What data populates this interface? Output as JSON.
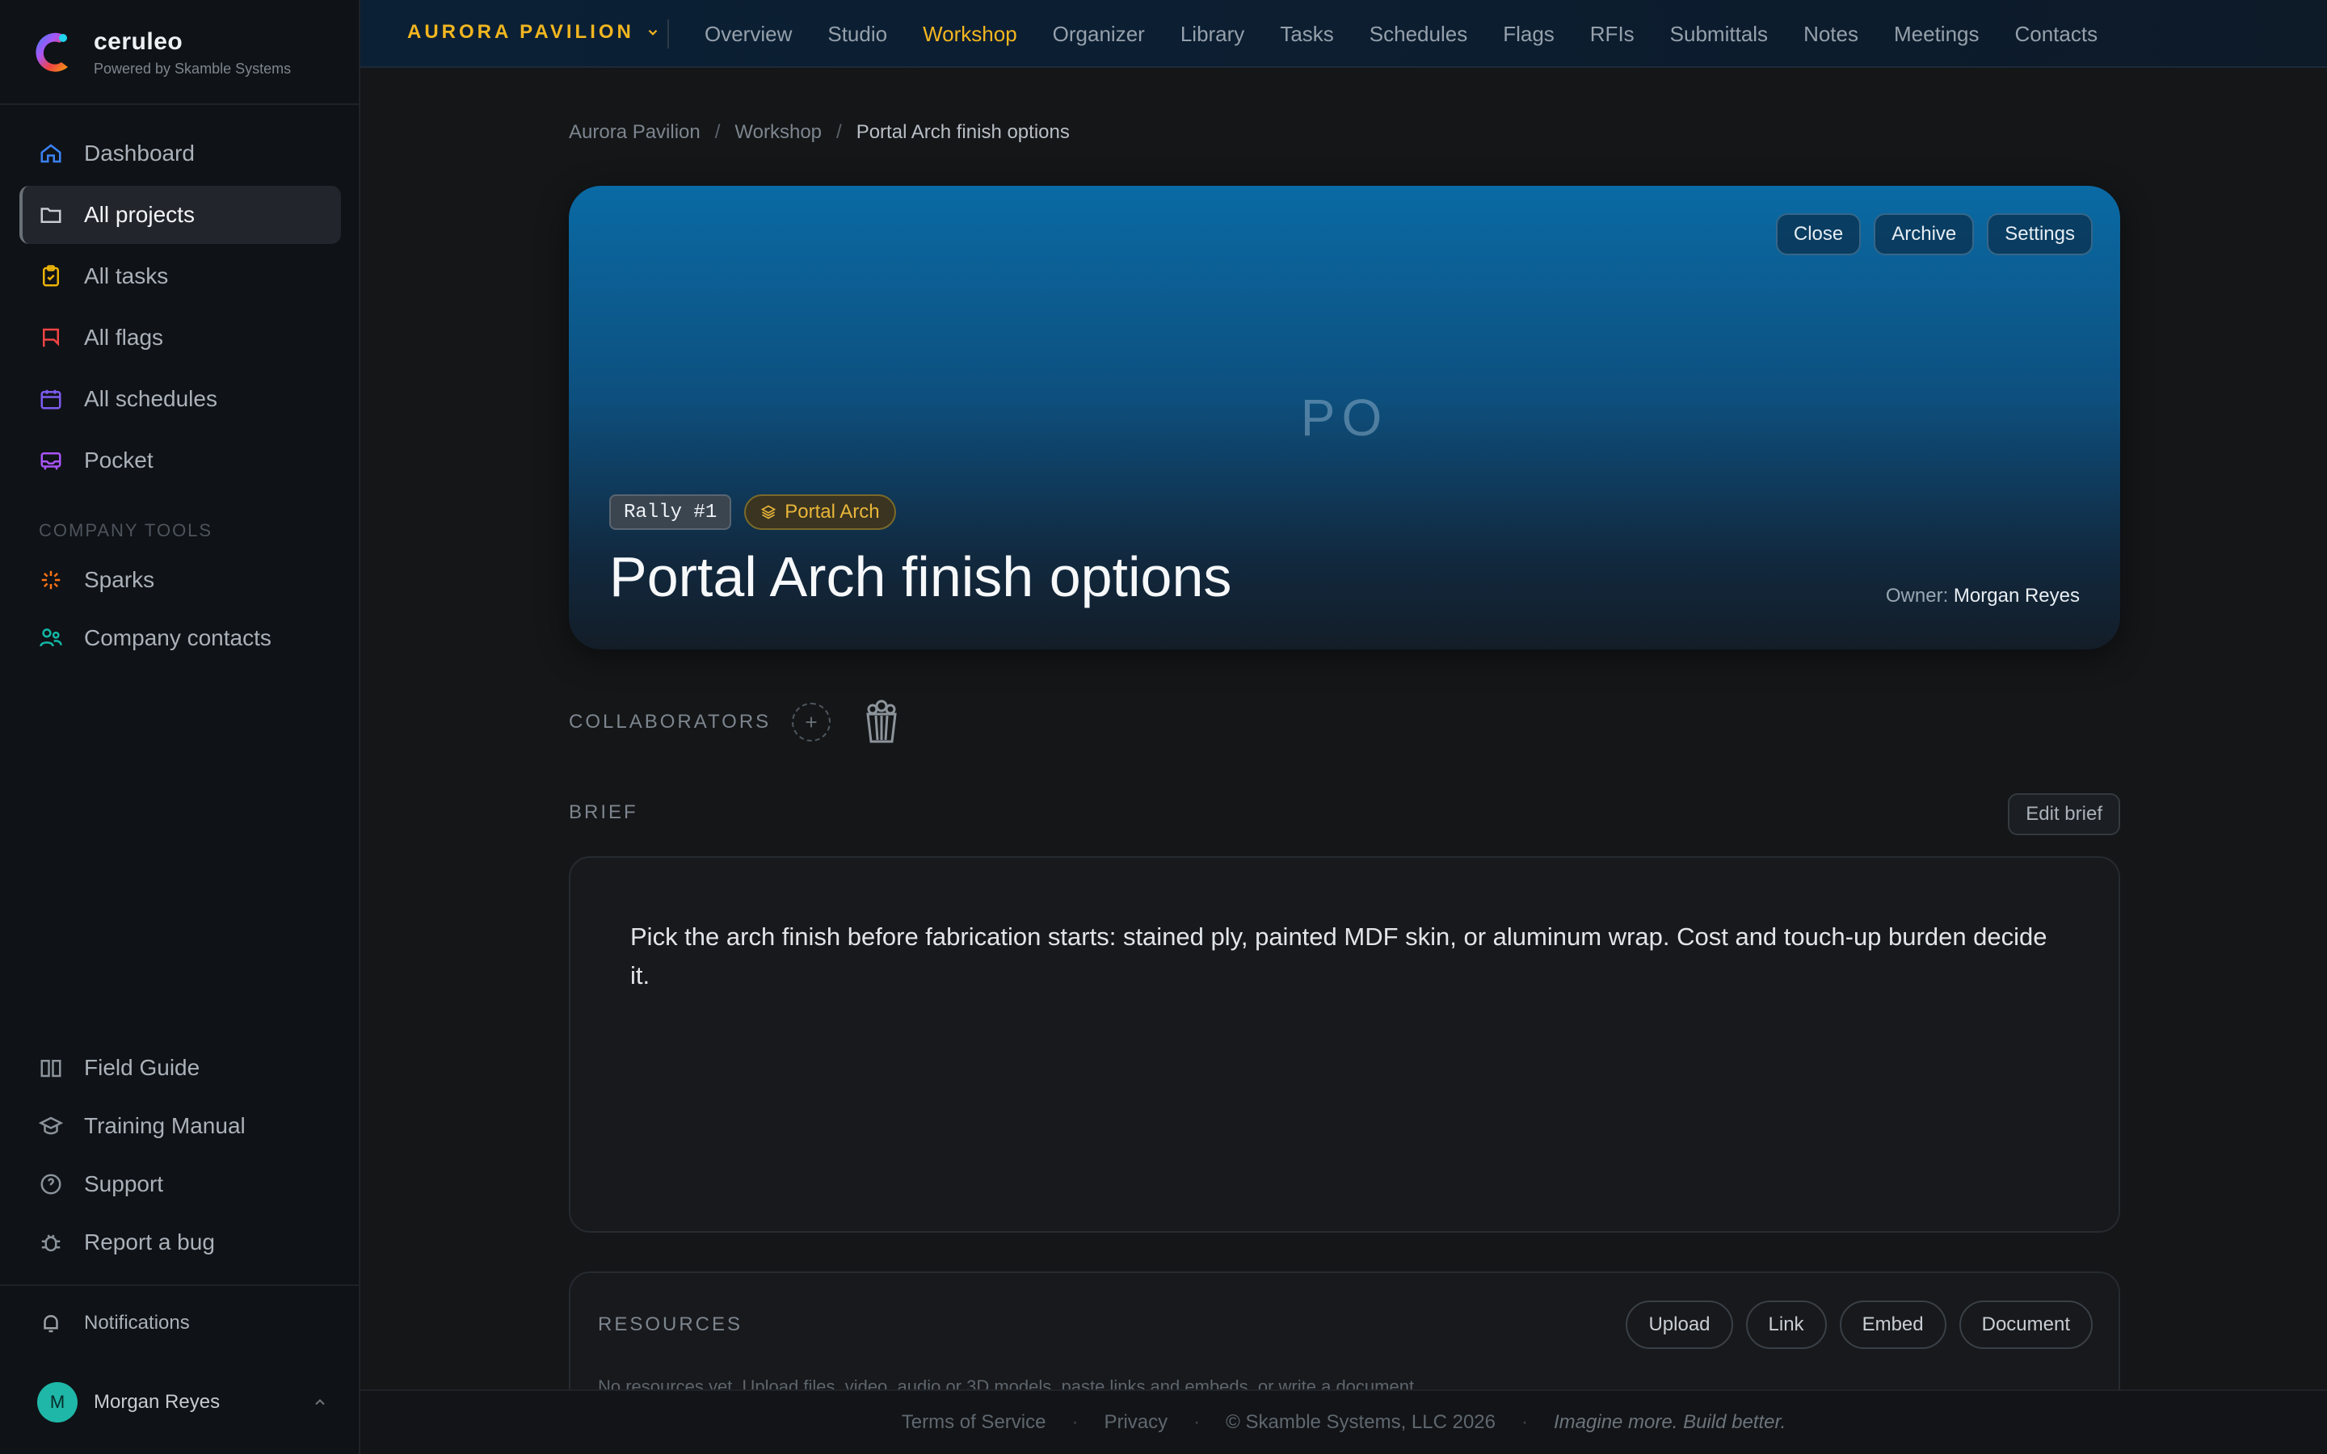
{
  "brand": {
    "name": "ceruleo",
    "subtitle": "Powered by Skamble Systems"
  },
  "sidebar": {
    "nav": [
      {
        "label": "Dashboard",
        "icon": "home-icon",
        "color": "#3b82f6"
      },
      {
        "label": "All projects",
        "icon": "folder-icon",
        "color": "#c7ccd2",
        "active": true
      },
      {
        "label": "All tasks",
        "icon": "clipboard-check-icon",
        "color": "#eab308"
      },
      {
        "label": "All flags",
        "icon": "flag-icon",
        "color": "#ef4444"
      },
      {
        "label": "All schedules",
        "icon": "calendar-icon",
        "color": "#7c5cf0"
      },
      {
        "label": "Pocket",
        "icon": "inbox-tray-icon",
        "color": "#a855f7"
      }
    ],
    "section_title": "COMPANY TOOLS",
    "tools": [
      {
        "label": "Sparks",
        "icon": "sparkle-icon",
        "color": "#f97316"
      },
      {
        "label": "Company contacts",
        "icon": "users-icon",
        "color": "#14b8a6"
      }
    ],
    "help": [
      {
        "label": "Field Guide",
        "icon": "book-open-icon"
      },
      {
        "label": "Training Manual",
        "icon": "graduation-cap-icon"
      },
      {
        "label": "Support",
        "icon": "help-circle-icon"
      },
      {
        "label": "Report a bug",
        "icon": "bug-icon"
      }
    ],
    "notifications": "Notifications",
    "user": {
      "initial": "M",
      "name": "Morgan Reyes"
    }
  },
  "topbar": {
    "project": "AURORA PAVILION",
    "tabs": [
      "Overview",
      "Studio",
      "Workshop",
      "Organizer",
      "Library",
      "Tasks",
      "Schedules",
      "Flags",
      "RFIs",
      "Submittals",
      "Notes",
      "Meetings",
      "Contacts"
    ],
    "active_tab": "Workshop",
    "accent": "#f2b61f"
  },
  "breadcrumb": [
    "Aurora Pavilion",
    "Workshop",
    "Portal Arch finish options"
  ],
  "hero": {
    "actions": [
      "Close",
      "Archive",
      "Settings"
    ],
    "initials": "PO",
    "rally": "Rally #1",
    "tag": "Portal Arch",
    "title": "Portal Arch finish options",
    "owner_label": "Owner:",
    "owner_name": "Morgan Reyes"
  },
  "collaborators": {
    "label": "COLLABORATORS"
  },
  "brief": {
    "label": "BRIEF",
    "edit": "Edit brief",
    "text": "Pick the arch finish before fabrication starts: stained ply, painted MDF skin, or aluminum wrap. Cost and touch-up burden decide it."
  },
  "resources": {
    "label": "RESOURCES",
    "actions": [
      "Upload",
      "Link",
      "Embed",
      "Document"
    ],
    "empty": "No resources yet. Upload files, video, audio or 3D models, paste links and embeds, or write a document."
  },
  "footer": {
    "terms": "Terms of Service",
    "privacy": "Privacy",
    "copyright": "© Skamble Systems, LLC 2026",
    "tagline": "Imagine more. Build better."
  }
}
